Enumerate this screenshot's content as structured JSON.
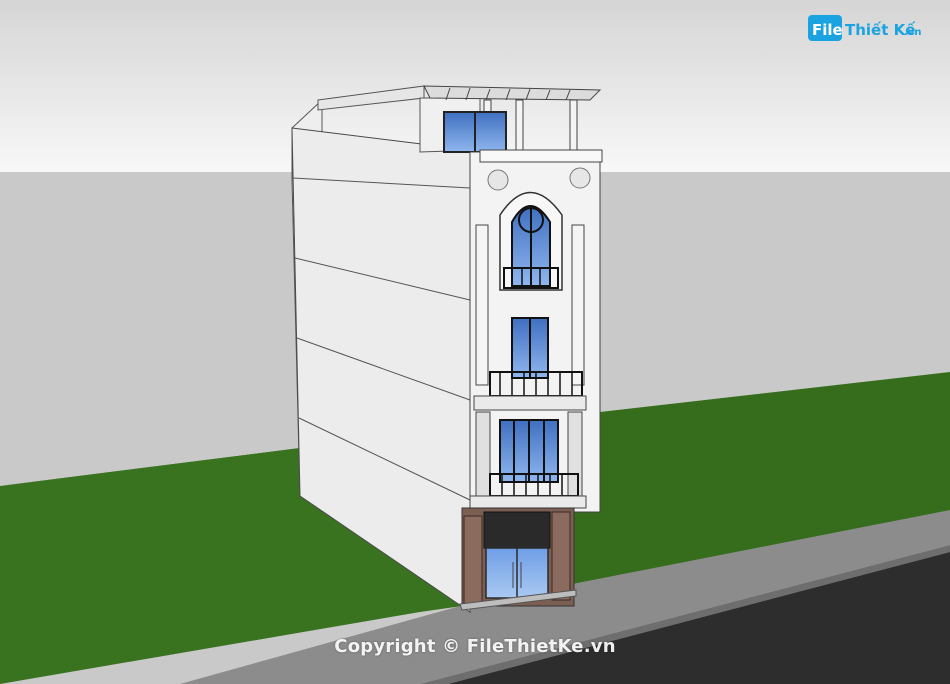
{
  "logo": {
    "file": "File",
    "rest": "Thiết Kế",
    "tld": ".vn"
  },
  "watermark": "Copyright © FileThietKe.vn",
  "colors": {
    "sky_top": "#d9d9d9",
    "sky_bottom": "#f6f6f6",
    "ground": "#c8c8c8",
    "lawn": "#356d1c",
    "sidewalk": "#8a8a8a",
    "road": "#2e2e2e",
    "facade": "#f2f2f2",
    "side_wall": "#ececec",
    "glass": "#5f8fd6",
    "stone": "#7a5e52",
    "logo_blue": "#1aa3e0"
  }
}
